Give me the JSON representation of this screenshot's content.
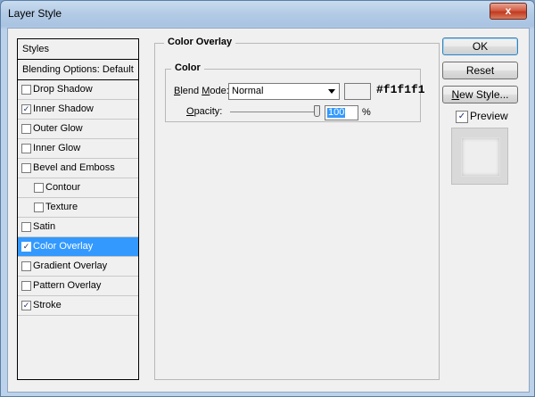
{
  "window": {
    "title": "Layer Style",
    "close_symbol": "x"
  },
  "styles_panel": {
    "header": "Styles",
    "blending_options": "Blending Options: Default",
    "items": [
      {
        "label": "Drop Shadow",
        "checked": false,
        "indent": false,
        "selected": false
      },
      {
        "label": "Inner Shadow",
        "checked": true,
        "indent": false,
        "selected": false
      },
      {
        "label": "Outer Glow",
        "checked": false,
        "indent": false,
        "selected": false
      },
      {
        "label": "Inner Glow",
        "checked": false,
        "indent": false,
        "selected": false
      },
      {
        "label": "Bevel and Emboss",
        "checked": false,
        "indent": false,
        "selected": false
      },
      {
        "label": "Contour",
        "checked": false,
        "indent": true,
        "selected": false
      },
      {
        "label": "Texture",
        "checked": false,
        "indent": true,
        "selected": false
      },
      {
        "label": "Satin",
        "checked": false,
        "indent": false,
        "selected": false
      },
      {
        "label": "Color Overlay",
        "checked": true,
        "indent": false,
        "selected": true
      },
      {
        "label": "Gradient Overlay",
        "checked": false,
        "indent": false,
        "selected": false
      },
      {
        "label": "Pattern Overlay",
        "checked": false,
        "indent": false,
        "selected": false
      },
      {
        "label": "Stroke",
        "checked": true,
        "indent": false,
        "selected": false
      }
    ]
  },
  "color_overlay": {
    "title": "Color Overlay",
    "color_group_title": "Color",
    "blend_mode_label": "Blend Mode:",
    "blend_mode_value": "Normal",
    "color_hex": "#f1f1f1",
    "opacity_label": "Opacity:",
    "opacity_value": "100",
    "opacity_unit": "%"
  },
  "buttons": {
    "ok": "OK",
    "reset": "Reset",
    "new_style": "New Style..."
  },
  "preview": {
    "label": "Preview",
    "checked": true
  },
  "check_mark": "✓",
  "colors": {
    "selection": "#3399ff",
    "swatch": "#f1f1f1"
  }
}
